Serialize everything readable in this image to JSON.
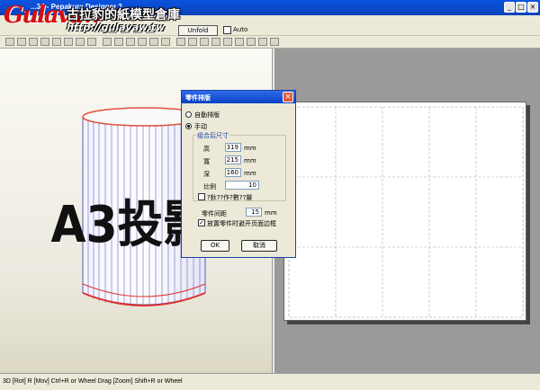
{
  "window": {
    "title": "...34 - Pepakura Designer 3",
    "min": "_",
    "max": "□",
    "close": "×"
  },
  "watermark": {
    "brand": "Gulavaw",
    "name": "古拉豹的紙模型倉庫",
    "url": "http://gulavaw.tw"
  },
  "toolbar": {
    "unfold_label": "Unfold",
    "auto_label": "Auto"
  },
  "model_text": "A3投影",
  "dialog": {
    "title": "零件排版",
    "auto_layout": "自動排版",
    "manual": "手动",
    "group_title": "组合后尺寸",
    "height_label": "高",
    "height_value": "319",
    "width_label": "寬",
    "width_value": "215",
    "depth_label": "深",
    "depth_value": "160",
    "unit": "mm",
    "scale_label": "比例",
    "scale_value": "10",
    "option1": "?鈥??作?數??層",
    "spacing_label": "零件间距",
    "spacing_value": "15",
    "option2": "放置零件时避开页面边框",
    "ok": "OK",
    "cancel": "取消"
  },
  "status": "3D [Rot] R [Mov] Ctrl+R or Wheel Drag [Zoom] Shift+R or Wheel"
}
